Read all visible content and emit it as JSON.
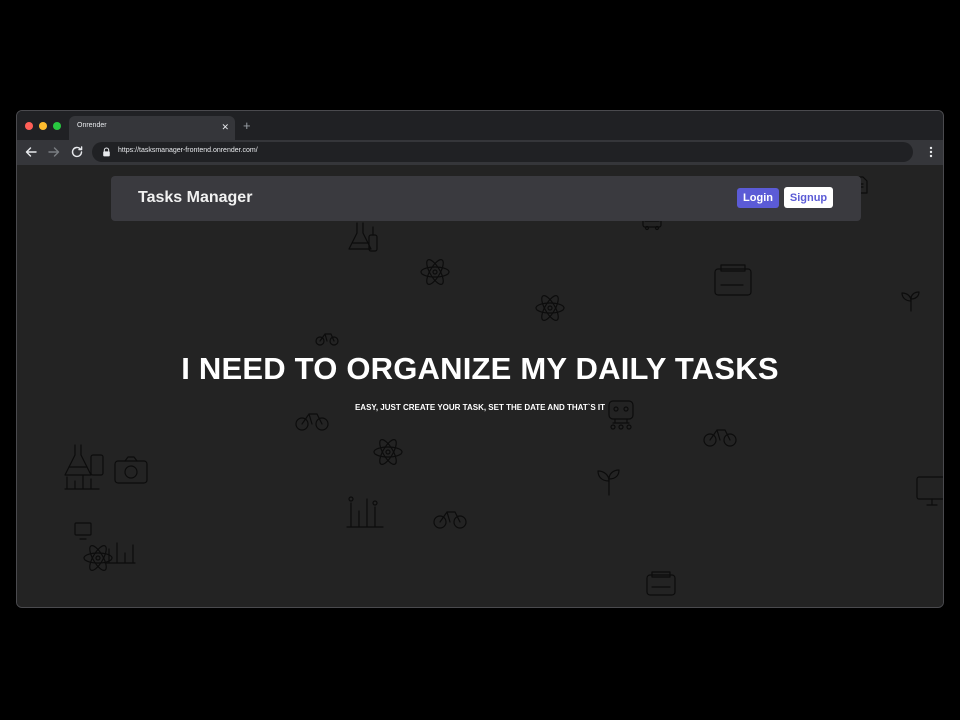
{
  "browser": {
    "tab_title": "Onrender",
    "tab_close": "✕",
    "new_tab": "+",
    "url": "https://tasksmanager-frontend.onrender.com/"
  },
  "navbar": {
    "brand": "Tasks Manager",
    "login_label": "Login",
    "signup_label": "Signup"
  },
  "hero": {
    "title": "I NEED TO ORGANIZE MY DAILY TASKS",
    "subtitle": "EASY, JUST CREATE YOUR TASK, SET THE DATE AND THAT`S IT"
  },
  "colors": {
    "page_background": "#232323",
    "navbar_background": "#3a3a3f",
    "accent": "#5b5bd6",
    "doodle_stroke": "#0c0c0c"
  }
}
